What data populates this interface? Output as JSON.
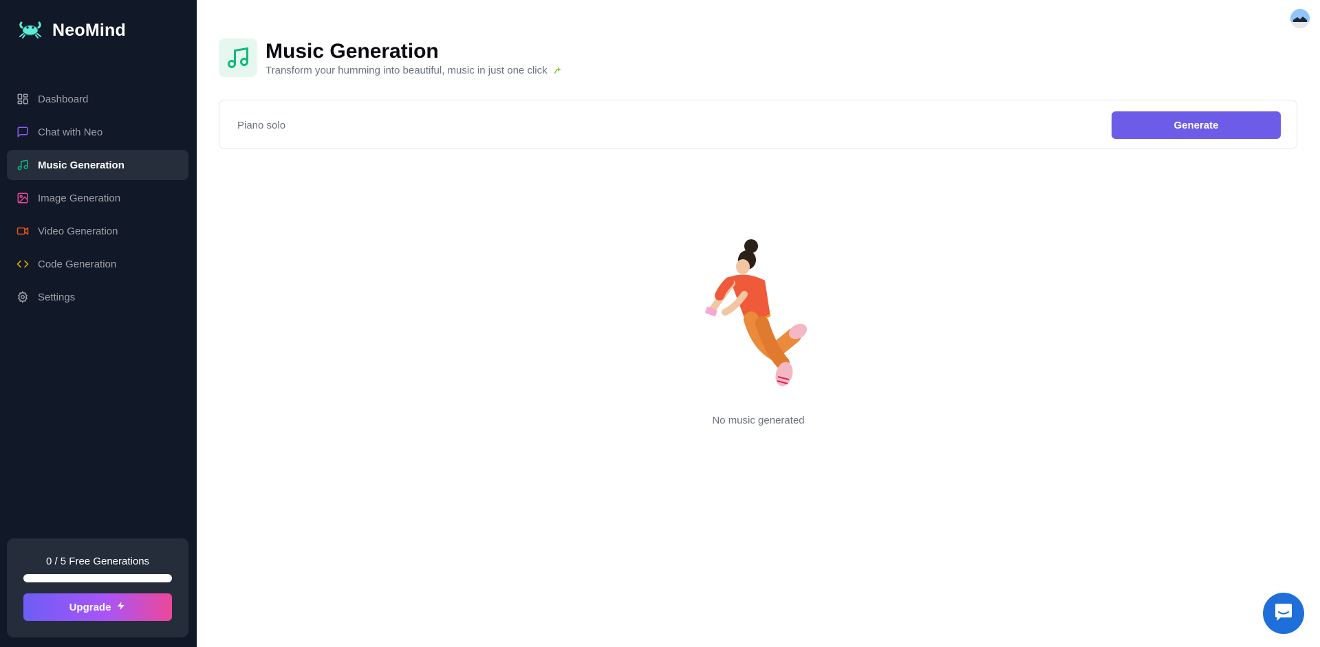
{
  "brand": {
    "name": "NeoMind",
    "logo_icon": "crab-icon"
  },
  "sidebar": {
    "items": [
      {
        "label": "Dashboard",
        "icon": "dashboard-icon",
        "color": "#a1a1aa",
        "active": false
      },
      {
        "label": "Chat with Neo",
        "icon": "message-square-icon",
        "color": "#8b5cf6",
        "active": false
      },
      {
        "label": "Music Generation",
        "icon": "music-icon",
        "color": "#10b981",
        "active": true
      },
      {
        "label": "Image Generation",
        "icon": "image-icon",
        "color": "#ec4899",
        "active": false
      },
      {
        "label": "Video Generation",
        "icon": "video-icon",
        "color": "#ea580c",
        "active": false
      },
      {
        "label": "Code Generation",
        "icon": "code-icon",
        "color": "#eab308",
        "active": false
      },
      {
        "label": "Settings",
        "icon": "settings-icon",
        "color": "#a1a1aa",
        "active": false
      }
    ],
    "usage": {
      "label": "0 / 5 Free Generations",
      "used": 0,
      "limit": 5,
      "progress_fraction": 0
    },
    "upgrade": {
      "label": "Upgrade",
      "icon": "zap-icon"
    }
  },
  "header": {
    "title": "Music Generation",
    "subtitle": "Transform your humming into beautiful, music in just one click",
    "subtitle_icon": "sparkle-icon",
    "icon": "music-icon",
    "accent": "#10b981"
  },
  "prompt": {
    "placeholder": "Piano solo",
    "value": ""
  },
  "generate_button": {
    "label": "Generate",
    "color": "#6c5ce7"
  },
  "empty_state": {
    "text": "No music generated",
    "illustration": "jumping-person-illustration"
  },
  "user": {
    "avatar": "avatar"
  },
  "support": {
    "icon": "chat-bubble-icon",
    "color": "#1e6fd9"
  }
}
